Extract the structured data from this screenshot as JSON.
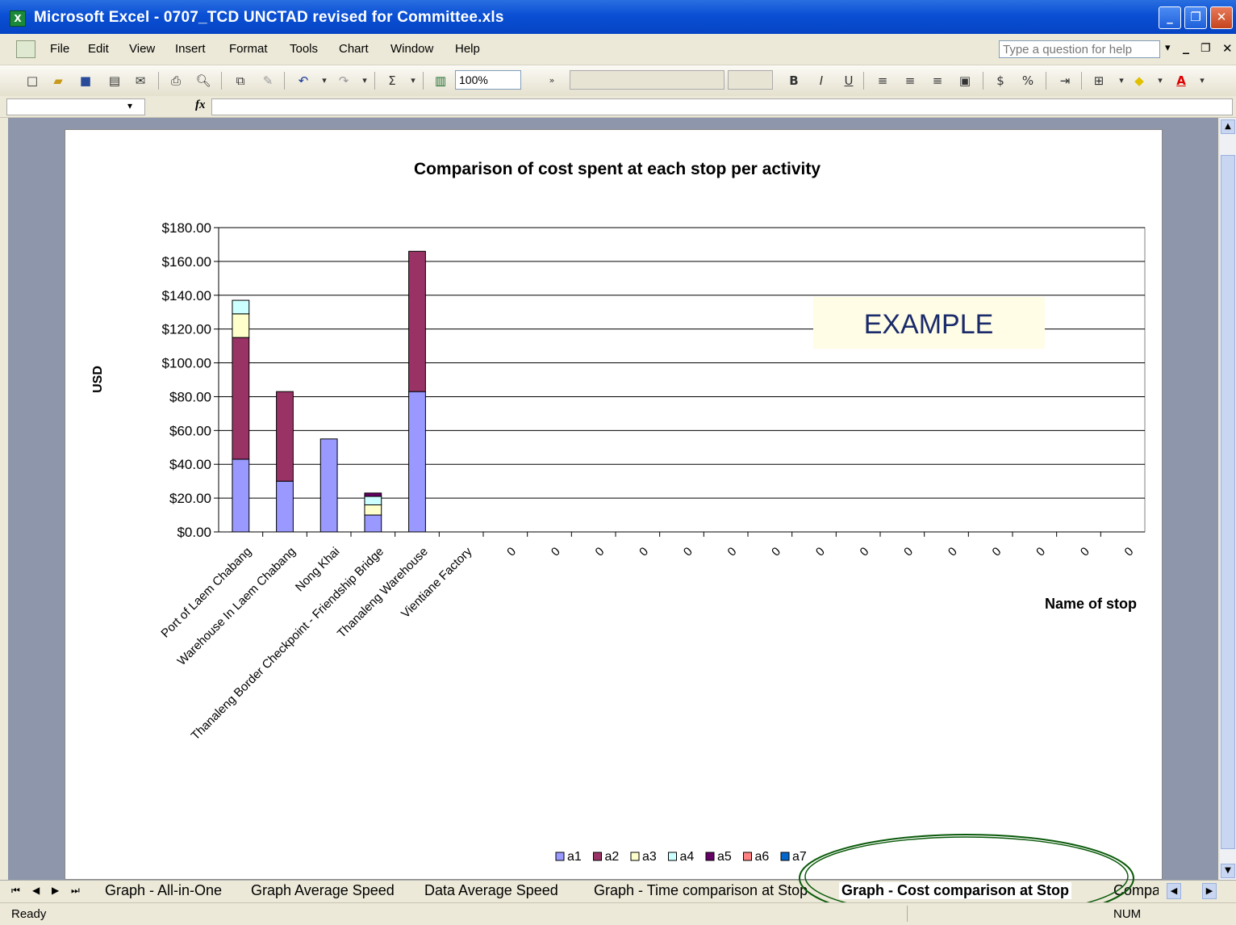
{
  "window": {
    "title": "Microsoft Excel - 0707_TCD UNCTAD revised for Committee.xls",
    "minimize": "_",
    "restore": "❐",
    "close": "✕"
  },
  "menu": {
    "items": [
      "File",
      "Edit",
      "View",
      "Insert",
      "Format",
      "Tools",
      "Chart",
      "Window",
      "Help"
    ],
    "help_placeholder": "Type a question for help"
  },
  "toolbar": {
    "zoom": "100%",
    "bold": "B",
    "italic": "I",
    "underline": "U",
    "currency": "$",
    "percent": "%"
  },
  "formula_bar": {
    "fx": "fx"
  },
  "chart_data": {
    "type": "bar",
    "stacked": true,
    "title": "Comparison of cost spent at each stop per activity",
    "ylabel": "USD",
    "xlabel": "Name of stop",
    "ylim": [
      0,
      180
    ],
    "yticks": [
      0,
      20,
      40,
      60,
      80,
      100,
      120,
      140,
      160,
      180
    ],
    "ytick_labels": [
      "$0.00",
      "$20.00",
      "$40.00",
      "$60.00",
      "$80.00",
      "$100.00",
      "$120.00",
      "$140.00",
      "$160.00",
      "$180.00"
    ],
    "grid": true,
    "categories": [
      "Port of Laem Chabang",
      "Warehouse In Laem Chabang",
      "Nong Khai",
      "Thanaleng Border Checkpoint - Friendship Bridge",
      "Thanaleng Warehouse",
      "Vientiane Factory",
      "0",
      "0",
      "0",
      "0",
      "0",
      "0",
      "0",
      "0",
      "0",
      "0",
      "0",
      "0",
      "0",
      "0",
      "0"
    ],
    "series": [
      {
        "name": "a1",
        "color": "#9999ff",
        "values": [
          43,
          30,
          55,
          10,
          83,
          0,
          0,
          0,
          0,
          0,
          0,
          0,
          0,
          0,
          0,
          0,
          0,
          0,
          0,
          0,
          0
        ]
      },
      {
        "name": "a2",
        "color": "#993366",
        "values": [
          72,
          53,
          0,
          0,
          83,
          0,
          0,
          0,
          0,
          0,
          0,
          0,
          0,
          0,
          0,
          0,
          0,
          0,
          0,
          0,
          0
        ]
      },
      {
        "name": "a3",
        "color": "#ffffcc",
        "values": [
          14,
          0,
          0,
          6,
          0,
          0,
          0,
          0,
          0,
          0,
          0,
          0,
          0,
          0,
          0,
          0,
          0,
          0,
          0,
          0,
          0
        ]
      },
      {
        "name": "a4",
        "color": "#ccffff",
        "values": [
          8,
          0,
          0,
          5,
          0,
          0,
          0,
          0,
          0,
          0,
          0,
          0,
          0,
          0,
          0,
          0,
          0,
          0,
          0,
          0,
          0
        ]
      },
      {
        "name": "a5",
        "color": "#660066",
        "values": [
          0,
          0,
          0,
          2,
          0,
          0,
          0,
          0,
          0,
          0,
          0,
          0,
          0,
          0,
          0,
          0,
          0,
          0,
          0,
          0,
          0
        ]
      },
      {
        "name": "a6",
        "color": "#ff8080",
        "values": [
          0,
          0,
          0,
          0,
          0,
          0,
          0,
          0,
          0,
          0,
          0,
          0,
          0,
          0,
          0,
          0,
          0,
          0,
          0,
          0,
          0
        ]
      },
      {
        "name": "a7",
        "color": "#0066cc",
        "values": [
          0,
          0,
          0,
          0,
          0,
          0,
          0,
          0,
          0,
          0,
          0,
          0,
          0,
          0,
          0,
          0,
          0,
          0,
          0,
          0,
          0
        ]
      }
    ],
    "legend_position": "bottom",
    "annotation": "EXAMPLE"
  },
  "sheet_tabs": {
    "tabs": [
      "Graph - All-in-One",
      "Graph Average Speed",
      "Data Average Speed",
      "Graph - Time comparison at Stop",
      "Graph - Cost comparison at Stop",
      "Compar"
    ],
    "active": "Graph - Cost comparison at Stop"
  },
  "status": {
    "ready": "Ready",
    "num": "NUM"
  }
}
